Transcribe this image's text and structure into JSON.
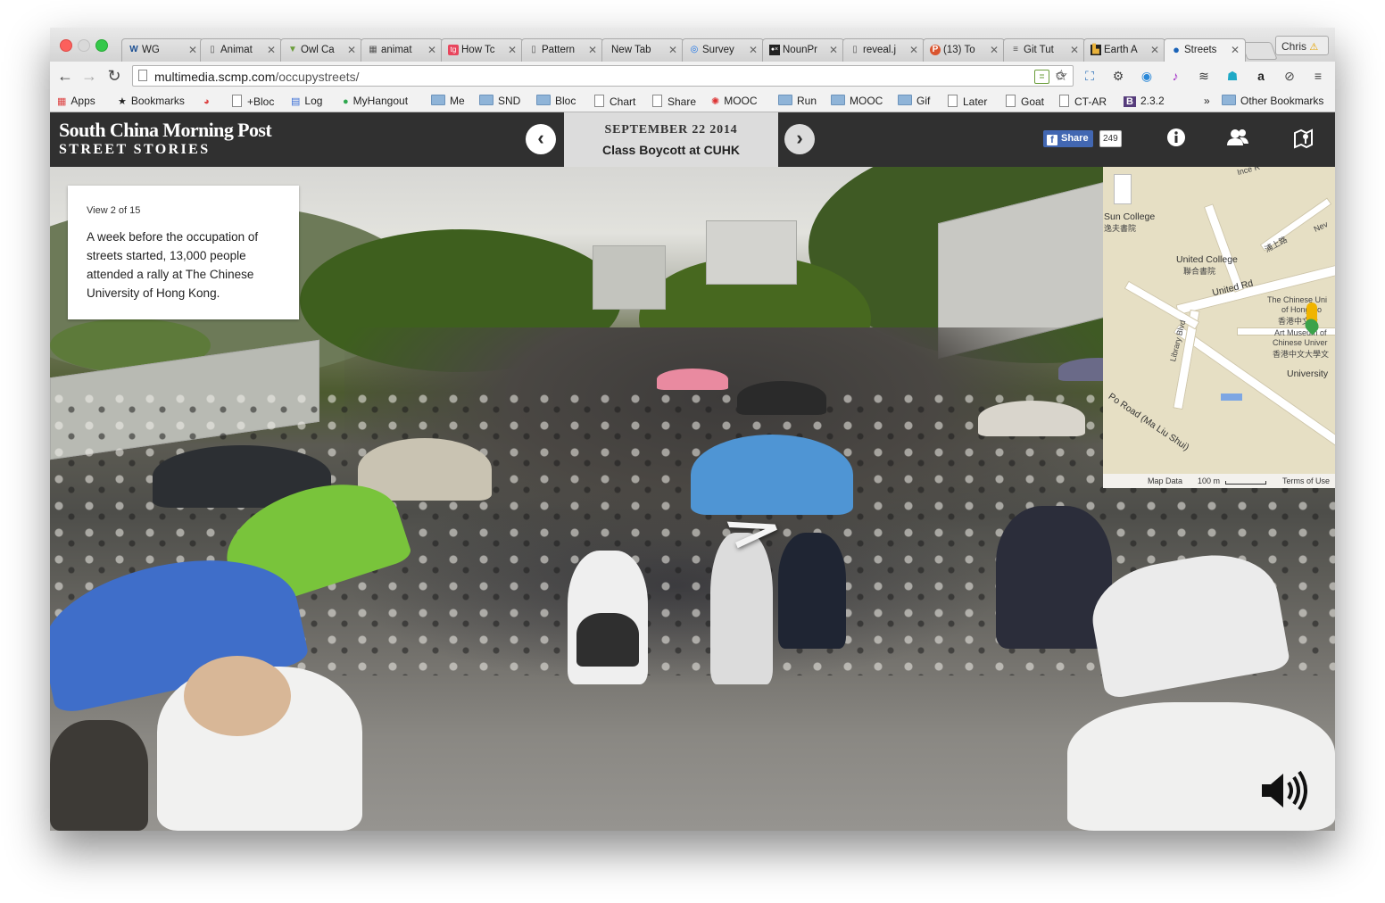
{
  "browser": {
    "tabs": [
      {
        "label": "WG",
        "icon": "W",
        "extra": "speaker"
      },
      {
        "label": "Animat",
        "icon": "doc"
      },
      {
        "label": "Owl Ca",
        "icon": "owl"
      },
      {
        "label": "animat",
        "icon": "grid"
      },
      {
        "label": "How Tc",
        "icon": "tg"
      },
      {
        "label": "Pattern",
        "icon": "doc"
      },
      {
        "label": "New Tab",
        "icon": ""
      },
      {
        "label": "Survey",
        "icon": "q"
      },
      {
        "label": "NounPr",
        "icon": "np"
      },
      {
        "label": "reveal.j",
        "icon": "doc"
      },
      {
        "label": "(13) To",
        "icon": "p"
      },
      {
        "label": "Git Tut",
        "icon": "db"
      },
      {
        "label": "Earth A",
        "icon": "earth"
      },
      {
        "label": "Streets",
        "icon": "streets",
        "active": true
      }
    ],
    "profile_name": "Chris",
    "url_host": "multimedia.scmp.com",
    "url_path": "/occupystreets/",
    "bookmarks": [
      {
        "label": "Apps",
        "type": "apps"
      },
      {
        "label": "Bookmarks",
        "type": "star"
      },
      {
        "label": "",
        "type": "chrome"
      },
      {
        "label": "+Bloc",
        "type": "doc"
      },
      {
        "label": "Log",
        "type": "log"
      },
      {
        "label": "MyHangout",
        "type": "hangout"
      },
      {
        "label": "Me",
        "type": "folder"
      },
      {
        "label": "SND",
        "type": "folder"
      },
      {
        "label": "Bloc",
        "type": "folder"
      },
      {
        "label": "Chart",
        "type": "doc"
      },
      {
        "label": "Share",
        "type": "doc"
      },
      {
        "label": "MOOC",
        "type": "mooc"
      },
      {
        "label": "Run",
        "type": "folder"
      },
      {
        "label": "MOOC",
        "type": "folder"
      },
      {
        "label": "Gif",
        "type": "folder"
      },
      {
        "label": "Later",
        "type": "doc"
      },
      {
        "label": "Goat",
        "type": "doc"
      },
      {
        "label": "CT-AR",
        "type": "doc"
      },
      {
        "label": "2.3.2",
        "type": "b"
      }
    ],
    "bookmarks_overflow": "»",
    "other_bookmarks": "Other Bookmarks"
  },
  "site": {
    "logo_main": "South China Morning Post",
    "logo_sub": "STREET STORIES",
    "date": "SEPTEMBER 22 2014",
    "story_title": "Class Boycott at CUHK",
    "share_label": "Share",
    "share_count": "249",
    "view_counter": "View 2 of 15",
    "description": "A week before the occupation of streets started, 13,000 people attended a rally at The Chinese University of Hong Kong."
  },
  "map": {
    "labels": [
      "Sun College",
      "逸夫書院",
      "United College",
      "聯合書院",
      "United Rd",
      "The Chinese Uni",
      "of Hong Ko",
      "香港中文大",
      "Art Museum of",
      "Chinese Univer",
      "香港中文大學文",
      "University",
      "Library Blvd",
      "Po Road (Ma Liu Shui)",
      "Ince R",
      "Nev",
      "浦上路"
    ],
    "footer_data": "Map Data",
    "footer_scale": "100 m",
    "footer_terms": "Terms of Use"
  },
  "colors": {
    "header_bg": "#303030",
    "datebox_bg": "#dcdcdc",
    "facebook": "#4267b2"
  }
}
